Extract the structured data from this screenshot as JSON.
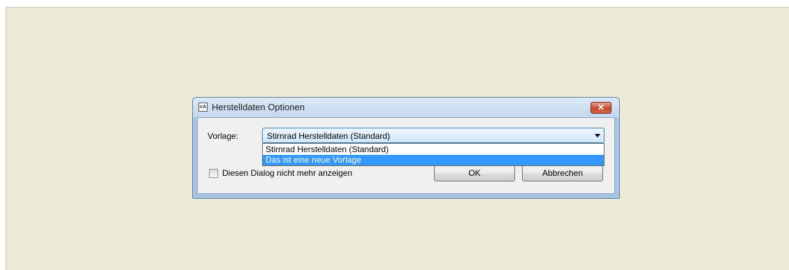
{
  "dialog": {
    "title": "Herstelldaten Optionen",
    "title_icon_text": "cA",
    "close_glyph": "✕"
  },
  "form": {
    "template_label": "Vorlage:",
    "template_selected": "Stirnrad Herstelldaten (Standard)",
    "template_options": [
      "Stirnrad Herstelldaten (Standard)",
      "Das ist eine neue Vorlage"
    ],
    "highlighted_option": "Das ist eine neue Vorlage",
    "dont_show_again_label": "Diesen Dialog nicht mehr anzeigen",
    "dont_show_again_checked": false
  },
  "buttons": {
    "ok": "OK",
    "cancel": "Abbrechen"
  },
  "colors": {
    "desktop": "#ecebd6",
    "highlight": "#3399ff",
    "close": "#c64a32"
  }
}
